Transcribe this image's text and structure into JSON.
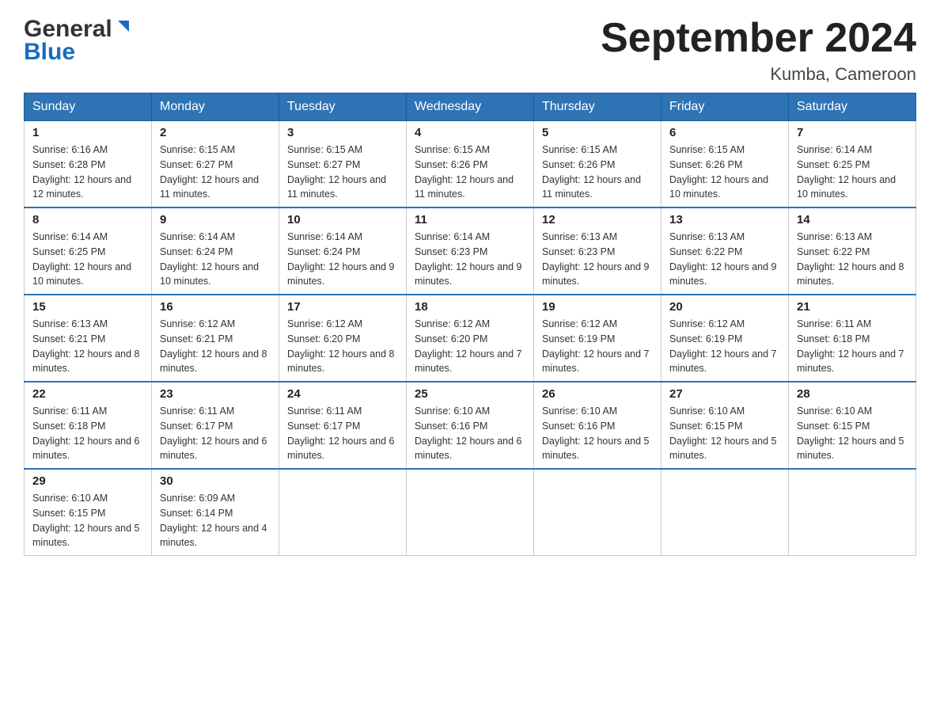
{
  "logo": {
    "general": "General",
    "blue": "Blue"
  },
  "header": {
    "month_year": "September 2024",
    "location": "Kumba, Cameroon"
  },
  "days_of_week": [
    "Sunday",
    "Monday",
    "Tuesday",
    "Wednesday",
    "Thursday",
    "Friday",
    "Saturday"
  ],
  "weeks": [
    [
      {
        "day": "1",
        "sunrise": "Sunrise: 6:16 AM",
        "sunset": "Sunset: 6:28 PM",
        "daylight": "Daylight: 12 hours and 12 minutes."
      },
      {
        "day": "2",
        "sunrise": "Sunrise: 6:15 AM",
        "sunset": "Sunset: 6:27 PM",
        "daylight": "Daylight: 12 hours and 11 minutes."
      },
      {
        "day": "3",
        "sunrise": "Sunrise: 6:15 AM",
        "sunset": "Sunset: 6:27 PM",
        "daylight": "Daylight: 12 hours and 11 minutes."
      },
      {
        "day": "4",
        "sunrise": "Sunrise: 6:15 AM",
        "sunset": "Sunset: 6:26 PM",
        "daylight": "Daylight: 12 hours and 11 minutes."
      },
      {
        "day": "5",
        "sunrise": "Sunrise: 6:15 AM",
        "sunset": "Sunset: 6:26 PM",
        "daylight": "Daylight: 12 hours and 11 minutes."
      },
      {
        "day": "6",
        "sunrise": "Sunrise: 6:15 AM",
        "sunset": "Sunset: 6:26 PM",
        "daylight": "Daylight: 12 hours and 10 minutes."
      },
      {
        "day": "7",
        "sunrise": "Sunrise: 6:14 AM",
        "sunset": "Sunset: 6:25 PM",
        "daylight": "Daylight: 12 hours and 10 minutes."
      }
    ],
    [
      {
        "day": "8",
        "sunrise": "Sunrise: 6:14 AM",
        "sunset": "Sunset: 6:25 PM",
        "daylight": "Daylight: 12 hours and 10 minutes."
      },
      {
        "day": "9",
        "sunrise": "Sunrise: 6:14 AM",
        "sunset": "Sunset: 6:24 PM",
        "daylight": "Daylight: 12 hours and 10 minutes."
      },
      {
        "day": "10",
        "sunrise": "Sunrise: 6:14 AM",
        "sunset": "Sunset: 6:24 PM",
        "daylight": "Daylight: 12 hours and 9 minutes."
      },
      {
        "day": "11",
        "sunrise": "Sunrise: 6:14 AM",
        "sunset": "Sunset: 6:23 PM",
        "daylight": "Daylight: 12 hours and 9 minutes."
      },
      {
        "day": "12",
        "sunrise": "Sunrise: 6:13 AM",
        "sunset": "Sunset: 6:23 PM",
        "daylight": "Daylight: 12 hours and 9 minutes."
      },
      {
        "day": "13",
        "sunrise": "Sunrise: 6:13 AM",
        "sunset": "Sunset: 6:22 PM",
        "daylight": "Daylight: 12 hours and 9 minutes."
      },
      {
        "day": "14",
        "sunrise": "Sunrise: 6:13 AM",
        "sunset": "Sunset: 6:22 PM",
        "daylight": "Daylight: 12 hours and 8 minutes."
      }
    ],
    [
      {
        "day": "15",
        "sunrise": "Sunrise: 6:13 AM",
        "sunset": "Sunset: 6:21 PM",
        "daylight": "Daylight: 12 hours and 8 minutes."
      },
      {
        "day": "16",
        "sunrise": "Sunrise: 6:12 AM",
        "sunset": "Sunset: 6:21 PM",
        "daylight": "Daylight: 12 hours and 8 minutes."
      },
      {
        "day": "17",
        "sunrise": "Sunrise: 6:12 AM",
        "sunset": "Sunset: 6:20 PM",
        "daylight": "Daylight: 12 hours and 8 minutes."
      },
      {
        "day": "18",
        "sunrise": "Sunrise: 6:12 AM",
        "sunset": "Sunset: 6:20 PM",
        "daylight": "Daylight: 12 hours and 7 minutes."
      },
      {
        "day": "19",
        "sunrise": "Sunrise: 6:12 AM",
        "sunset": "Sunset: 6:19 PM",
        "daylight": "Daylight: 12 hours and 7 minutes."
      },
      {
        "day": "20",
        "sunrise": "Sunrise: 6:12 AM",
        "sunset": "Sunset: 6:19 PM",
        "daylight": "Daylight: 12 hours and 7 minutes."
      },
      {
        "day": "21",
        "sunrise": "Sunrise: 6:11 AM",
        "sunset": "Sunset: 6:18 PM",
        "daylight": "Daylight: 12 hours and 7 minutes."
      }
    ],
    [
      {
        "day": "22",
        "sunrise": "Sunrise: 6:11 AM",
        "sunset": "Sunset: 6:18 PM",
        "daylight": "Daylight: 12 hours and 6 minutes."
      },
      {
        "day": "23",
        "sunrise": "Sunrise: 6:11 AM",
        "sunset": "Sunset: 6:17 PM",
        "daylight": "Daylight: 12 hours and 6 minutes."
      },
      {
        "day": "24",
        "sunrise": "Sunrise: 6:11 AM",
        "sunset": "Sunset: 6:17 PM",
        "daylight": "Daylight: 12 hours and 6 minutes."
      },
      {
        "day": "25",
        "sunrise": "Sunrise: 6:10 AM",
        "sunset": "Sunset: 6:16 PM",
        "daylight": "Daylight: 12 hours and 6 minutes."
      },
      {
        "day": "26",
        "sunrise": "Sunrise: 6:10 AM",
        "sunset": "Sunset: 6:16 PM",
        "daylight": "Daylight: 12 hours and 5 minutes."
      },
      {
        "day": "27",
        "sunrise": "Sunrise: 6:10 AM",
        "sunset": "Sunset: 6:15 PM",
        "daylight": "Daylight: 12 hours and 5 minutes."
      },
      {
        "day": "28",
        "sunrise": "Sunrise: 6:10 AM",
        "sunset": "Sunset: 6:15 PM",
        "daylight": "Daylight: 12 hours and 5 minutes."
      }
    ],
    [
      {
        "day": "29",
        "sunrise": "Sunrise: 6:10 AM",
        "sunset": "Sunset: 6:15 PM",
        "daylight": "Daylight: 12 hours and 5 minutes."
      },
      {
        "day": "30",
        "sunrise": "Sunrise: 6:09 AM",
        "sunset": "Sunset: 6:14 PM",
        "daylight": "Daylight: 12 hours and 4 minutes."
      },
      null,
      null,
      null,
      null,
      null
    ]
  ]
}
